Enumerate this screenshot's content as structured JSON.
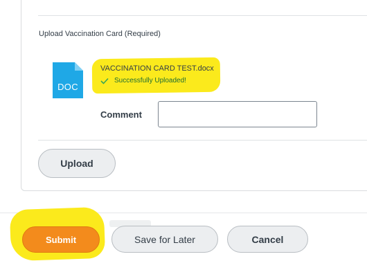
{
  "upload_section": {
    "label": "Upload Vaccination Card (Required)",
    "file": {
      "icon_text": "DOC",
      "name": "VACCINATION CARD TEST.docx",
      "status": "Successfully Uploaded!"
    },
    "comment": {
      "label": "Comment",
      "value": "",
      "placeholder": ""
    },
    "upload_label": "Upload"
  },
  "footer": {
    "submit_label": "Submit",
    "save_later_label": "Save for Later",
    "cancel_label": "Cancel"
  },
  "colors": {
    "doc_icon": "#1fa8e6",
    "highlight": "#fbea1c",
    "submit": "#f38b1c",
    "success": "#3aa657"
  },
  "icons": {
    "file": "doc-file-icon",
    "success": "check-icon"
  }
}
